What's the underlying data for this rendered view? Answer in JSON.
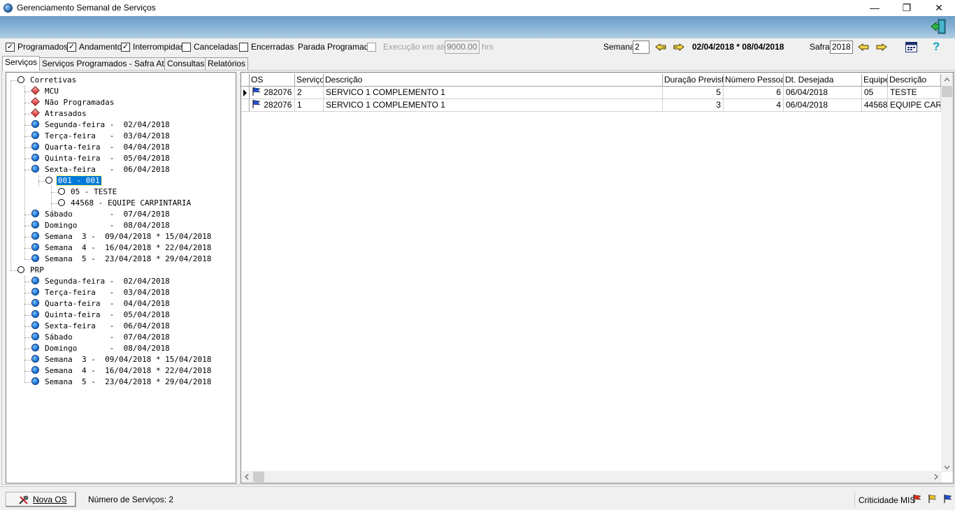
{
  "window": {
    "title": "Gerenciamento Semanal de Serviços",
    "minimize": "—",
    "restore": "❐",
    "close": "✕"
  },
  "filters": {
    "items": [
      {
        "label": "Programados",
        "checked": true
      },
      {
        "label": "Andamento",
        "checked": true
      },
      {
        "label": "Interrompidas",
        "checked": true
      },
      {
        "label": "Canceladas",
        "checked": false
      },
      {
        "label": "Encerradas",
        "checked": false
      }
    ],
    "parada_label": "Parada Programada",
    "exec_label": "Execução em até",
    "exec_value": "9000.00",
    "exec_unit": "hrs",
    "semana_label": "Semana",
    "semana_value": "2",
    "week_range": "02/04/2018 * 08/04/2018",
    "safra_label": "Safra",
    "safra_value": "2018"
  },
  "tabs": [
    "Serviços",
    "Serviços Programados - Safra Atual",
    "Consultas",
    "Relatórios"
  ],
  "tree": [
    {
      "text": "Corretivas",
      "icon": "open",
      "level": 0
    },
    {
      "text": "MCU",
      "icon": "red",
      "level": 1
    },
    {
      "text": "Não Programadas",
      "icon": "red",
      "level": 1
    },
    {
      "text": "Atrasados",
      "icon": "red",
      "level": 1
    },
    {
      "text": "Segunda-feira -  02/04/2018",
      "icon": "blue",
      "level": 1
    },
    {
      "text": "Terça-feira   -  03/04/2018",
      "icon": "blue",
      "level": 1
    },
    {
      "text": "Quarta-feira  -  04/04/2018",
      "icon": "blue",
      "level": 1
    },
    {
      "text": "Quinta-feira  -  05/04/2018",
      "icon": "blue",
      "level": 1
    },
    {
      "text": "Sexta-feira   -  06/04/2018",
      "icon": "blue",
      "level": 1
    },
    {
      "text": "001 - 001",
      "icon": "open",
      "level": 2,
      "selected": true
    },
    {
      "text": "05 - TESTE",
      "icon": "open",
      "level": 3
    },
    {
      "text": "44568 - EQUIPE CARPINTARIA",
      "icon": "open",
      "level": 3
    },
    {
      "text": "Sábado        -  07/04/2018",
      "icon": "blue",
      "level": 1
    },
    {
      "text": "Domingo       -  08/04/2018",
      "icon": "blue",
      "level": 1
    },
    {
      "text": "Semana  3 -  09/04/2018 * 15/04/2018",
      "icon": "blue",
      "level": 1
    },
    {
      "text": "Semana  4 -  16/04/2018 * 22/04/2018",
      "icon": "blue",
      "level": 1
    },
    {
      "text": "Semana  5 -  23/04/2018 * 29/04/2018",
      "icon": "blue",
      "level": 1
    },
    {
      "text": "PRP",
      "icon": "open",
      "level": 0
    },
    {
      "text": "Segunda-feira -  02/04/2018",
      "icon": "blue",
      "level": 1
    },
    {
      "text": "Terça-feira   -  03/04/2018",
      "icon": "blue",
      "level": 1
    },
    {
      "text": "Quarta-feira  -  04/04/2018",
      "icon": "blue",
      "level": 1
    },
    {
      "text": "Quinta-feira  -  05/04/2018",
      "icon": "blue",
      "level": 1
    },
    {
      "text": "Sexta-feira   -  06/04/2018",
      "icon": "blue",
      "level": 1
    },
    {
      "text": "Sábado        -  07/04/2018",
      "icon": "blue",
      "level": 1
    },
    {
      "text": "Domingo       -  08/04/2018",
      "icon": "blue",
      "level": 1
    },
    {
      "text": "Semana  3 -  09/04/2018 * 15/04/2018",
      "icon": "blue",
      "level": 1
    },
    {
      "text": "Semana  4 -  16/04/2018 * 22/04/2018",
      "icon": "blue",
      "level": 1
    },
    {
      "text": "Semana  5 -  23/04/2018 * 29/04/2018",
      "icon": "blue",
      "level": 1
    }
  ],
  "grid": {
    "columns": [
      "OS",
      "Serviço",
      "Descrição",
      "Duração Prevista",
      "Número Pessoas",
      "Dt. Desejada",
      "Equipe",
      "Descrição"
    ],
    "rows": [
      [
        "282076",
        "2",
        "SERVICO 1 COMPLEMENTO 1",
        "5",
        "6",
        "06/04/2018",
        "05",
        "TESTE"
      ],
      [
        "282076",
        "1",
        "SERVICO 1 COMPLEMENTO 1",
        "3",
        "4",
        "06/04/2018",
        "44568",
        "EQUIPE CARP"
      ]
    ],
    "flag_color": "#1f4fd0"
  },
  "status": {
    "new_button": "Nova OS",
    "count_label": "Número de Serviços: 2",
    "criticality_label": "Criticidade MIS",
    "flag_colors": [
      "#e03020",
      "#e8c020",
      "#1f4fd0"
    ]
  }
}
